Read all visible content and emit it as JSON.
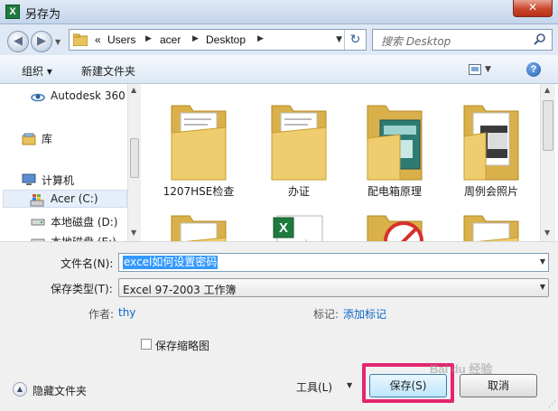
{
  "window": {
    "title": "另存为",
    "app_icon": "X",
    "close_glyph": "✕"
  },
  "nav": {
    "back_glyph": "◀",
    "forward_glyph": "▶",
    "breadcrumb_overflow": "«",
    "breadcrumb": [
      "Users",
      "acer",
      "Desktop"
    ],
    "search_placeholder": "搜索 Desktop"
  },
  "toolbar": {
    "organize": "组织 ▾",
    "new_folder": "新建文件夹",
    "help": "?"
  },
  "sidebar": {
    "items": [
      {
        "label": "Autodesk 360",
        "icon": "autodesk-360-icon"
      },
      {
        "label": "库",
        "icon": "library-icon"
      },
      {
        "label": "计算机",
        "icon": "computer-icon"
      },
      {
        "label": "Acer (C:)",
        "icon": "windows-drive-icon",
        "selected": true
      },
      {
        "label": "本地磁盘 (D:)",
        "icon": "hard-disk-icon"
      },
      {
        "label": "本地磁盘 (E:)",
        "icon": "hard-disk-icon"
      }
    ]
  },
  "files": [
    {
      "label": "1207HSE检查",
      "icon": "folder-icon"
    },
    {
      "label": "办证",
      "icon": "folder-icon"
    },
    {
      "label": "配电箱原理",
      "icon": "folder-icon"
    },
    {
      "label": "周例会照片",
      "icon": "folder-icon"
    },
    {
      "label": "",
      "icon": "folder-icon"
    },
    {
      "label": "",
      "icon": "excel-file-icon"
    },
    {
      "label": "",
      "icon": "folder-icon"
    },
    {
      "label": "",
      "icon": "folder-icon"
    }
  ],
  "form": {
    "filename_label": "文件名(N):",
    "filename_value": "excel如何设置密码",
    "filetype_label": "保存类型(T):",
    "filetype_value": "Excel 97-2003 工作簿",
    "author_label": "作者:",
    "author_value": "thy",
    "tags_label": "标记:",
    "tags_value": "添加标记",
    "thumbnail_label": "保存缩略图",
    "hide_folders_label": "隐藏文件夹",
    "tools_label": "工具(L)",
    "save_label": "保存(S)",
    "cancel_label": "取消"
  },
  "colors": {
    "highlight": "#e3266f",
    "link": "#0a64c8",
    "selection": "#3399ff"
  }
}
